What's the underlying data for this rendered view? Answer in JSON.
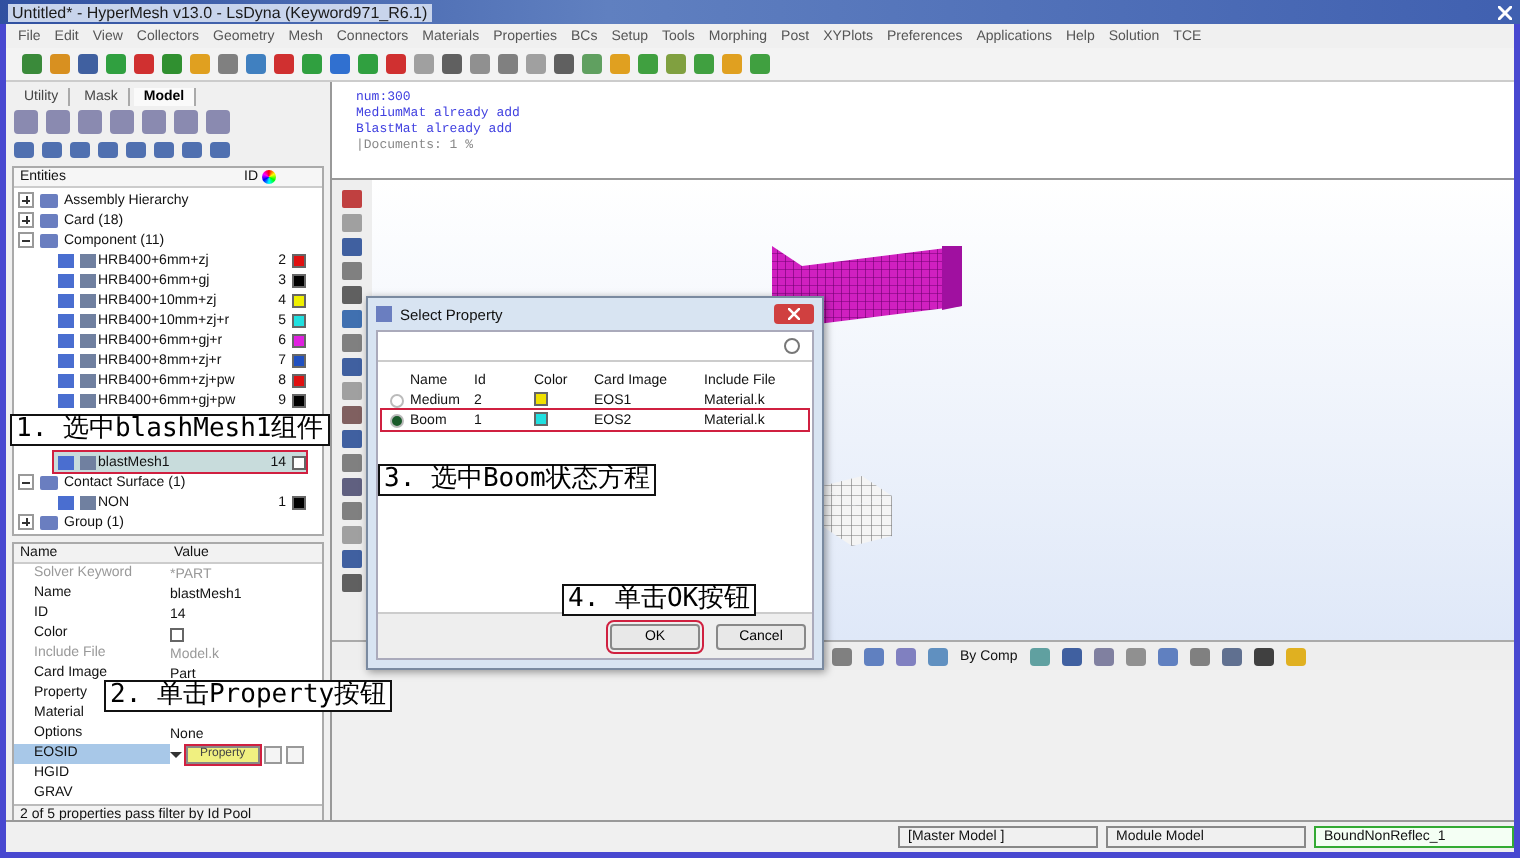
{
  "window": {
    "title": "Untitled* - HyperMesh v13.0 - LsDyna (Keyword971_R6.1)"
  },
  "menu": [
    "File",
    "Edit",
    "View",
    "Collectors",
    "Geometry",
    "Mesh",
    "Connectors",
    "Materials",
    "Properties",
    "BCs",
    "Setup",
    "Tools",
    "Morphing",
    "Post",
    "XYPlots",
    "Preferences",
    "Applications",
    "Help",
    "Solution",
    "TCE"
  ],
  "left_tabs": [
    {
      "label": "Utility",
      "selected": false
    },
    {
      "label": "Mask",
      "selected": false
    },
    {
      "label": "Model",
      "selected": true
    }
  ],
  "entities": {
    "header": "Entities",
    "id_header": "ID",
    "tree": [
      {
        "label": "Assembly Hierarchy",
        "expanded": false
      },
      {
        "label": "Card (18)",
        "expanded": false
      },
      {
        "label": "Component (11)",
        "expanded": true,
        "children": [
          {
            "label": "HRB400+6mm+zj",
            "id": "2",
            "color": "#e01010",
            "selected": false,
            "highlighted": false
          },
          {
            "label": "HRB400+6mm+gj",
            "id": "3",
            "color": "#000000",
            "selected": false,
            "highlighted": false
          },
          {
            "label": "HRB400+10mm+zj",
            "id": "4",
            "color": "#f0f000",
            "selected": false,
            "highlighted": false
          },
          {
            "label": "HRB400+10mm+zj+r",
            "id": "5",
            "color": "#20e0e0",
            "selected": false,
            "highlighted": false
          },
          {
            "label": "HRB400+6mm+gj+r",
            "id": "6",
            "color": "#e020e0",
            "selected": false,
            "highlighted": false
          },
          {
            "label": "HRB400+8mm+zj+r",
            "id": "7",
            "color": "#2050c0",
            "selected": false,
            "highlighted": false
          },
          {
            "label": "HRB400+6mm+zj+pw",
            "id": "8",
            "color": "#e01010",
            "selected": false,
            "highlighted": false
          },
          {
            "label": "HRB400+6mm+gj+pw",
            "id": "9",
            "color": "#000000",
            "selected": false,
            "highlighted": false
          },
          {
            "label": "blastMesh1",
            "id": "14",
            "color": "#ffffff",
            "selected": true,
            "highlighted": true
          }
        ]
      },
      {
        "label": "Contact Surface (1)",
        "expanded": true,
        "children": [
          {
            "label": "NON",
            "id": "1",
            "color": "#000000",
            "selected": false,
            "highlighted": false
          }
        ]
      },
      {
        "label": "Group (1)",
        "expanded": false
      }
    ]
  },
  "properties": {
    "columns": [
      "Name",
      "Value"
    ],
    "rows": [
      {
        "kind": "text",
        "name": "Solver Keyword",
        "value": "*PART",
        "disabled": true,
        "selected": false
      },
      {
        "kind": "text",
        "name": "Name",
        "value": "blastMesh1",
        "disabled": false,
        "selected": false
      },
      {
        "kind": "text",
        "name": "ID",
        "value": "14",
        "disabled": false,
        "selected": false
      },
      {
        "kind": "color",
        "name": "Color",
        "color": "#ffffff",
        "disabled": false,
        "selected": false
      },
      {
        "kind": "text",
        "name": "Include File",
        "value": "Model.k",
        "disabled": true,
        "selected": false
      },
      {
        "kind": "text",
        "name": "Card Image",
        "value": "Part",
        "disabled": false,
        "selected": false
      },
      {
        "kind": "text",
        "name": "Property",
        "disabled": false,
        "selected": false
      },
      {
        "kind": "text",
        "name": "Material",
        "disabled": false,
        "selected": false
      },
      {
        "kind": "text",
        "name": "Options",
        "value": "None",
        "disabled": false,
        "selected": false
      },
      {
        "kind": "button",
        "name": "EOSID",
        "button": "Property",
        "highlighted": true,
        "disabled": false,
        "selected": true
      },
      {
        "kind": "text",
        "name": "HGID",
        "disabled": false,
        "selected": false
      },
      {
        "kind": "text",
        "name": "GRAV",
        "disabled": false,
        "selected": false
      }
    ],
    "status": "2 of 5 properties pass filter by Id Pool"
  },
  "console": [
    "num:300",
    "MediumMat already add",
    "BlastMat already add",
    "|Documents: 1 %"
  ],
  "view_toolbar": {
    "display_mode": "By Comp"
  },
  "status_bar": [
    "[Master Model ]",
    "Module Model",
    "BoundNonReflec_1"
  ],
  "dialog": {
    "title": "Select Property",
    "columns": [
      "Name",
      "Id",
      "Color",
      "Card Image",
      "Include File"
    ],
    "rows": [
      {
        "name": "Medium",
        "id": "2",
        "color": "#f0e000",
        "card_image": "EOS1",
        "include_file": "Material.k",
        "selected": false,
        "highlighted": false
      },
      {
        "name": "Boom",
        "id": "1",
        "color": "#20e0e0",
        "card_image": "EOS2",
        "include_file": "Material.k",
        "selected": true,
        "highlighted": true
      }
    ],
    "buttons": [
      {
        "label": "OK",
        "highlighted": true
      },
      {
        "label": "Cancel",
        "highlighted": false
      }
    ]
  },
  "annotations": [
    "1. 选中blashMesh1组件",
    "2. 单击Property按钮",
    "3. 选中Boom状态方程",
    "4. 单击OK按钮"
  ]
}
